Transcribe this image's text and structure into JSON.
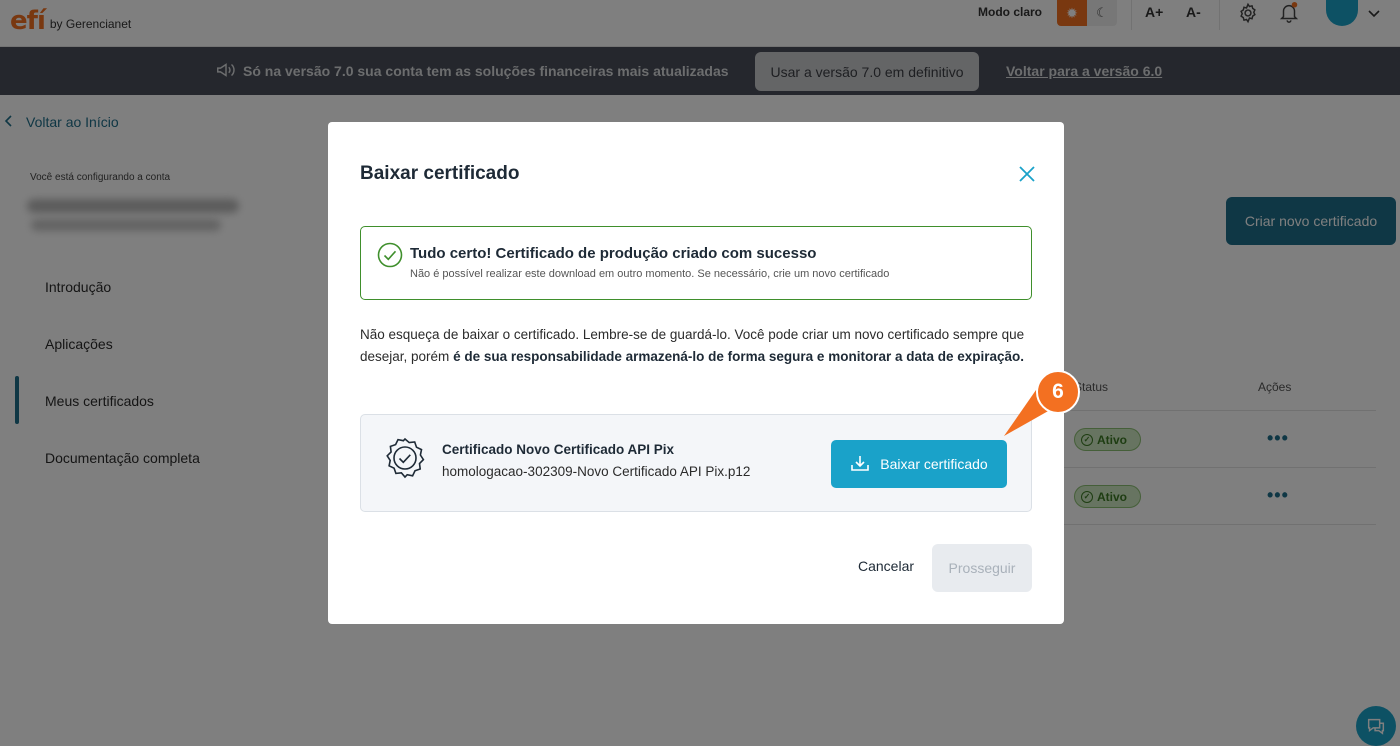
{
  "header": {
    "logo_text": "efí",
    "logo_sub": "by Gerencianet",
    "mode_label": "Modo claro",
    "font_increase": "A+",
    "font_decrease": "A-"
  },
  "banner": {
    "message": "Só na versão 7.0 sua conta tem as soluções financeiras mais atualizadas",
    "primary_button": "Usar a versão 7.0 em definitivo",
    "secondary_link": "Voltar para a versão 6.0"
  },
  "sidebar": {
    "back_label": "Voltar ao Início",
    "account_hint": "Você está configurando a conta",
    "items": [
      {
        "label": "Introdução"
      },
      {
        "label": "Aplicações"
      },
      {
        "label": "Meus certificados"
      },
      {
        "label": "Documentação completa"
      }
    ]
  },
  "main": {
    "create_button": "Criar novo certificado",
    "columns": {
      "status": "Status",
      "actions": "Ações"
    },
    "rows": [
      {
        "status": "Ativo",
        "actions": "•••"
      },
      {
        "status": "Ativo",
        "actions": "•••"
      }
    ]
  },
  "modal": {
    "title": "Baixar certificado",
    "success_title": "Tudo certo! Certificado de produção criado com sucesso",
    "success_subtitle": "Não é possível realizar este download em outro momento. Se necessário, crie um novo certificado",
    "text_intro": "Não esqueça de baixar o certificado. Lembre-se de guardá-lo. Você pode criar um novo certificado sempre que desejar, porém ",
    "text_bold": "é de sua responsabilidade armazená-lo de forma segura e monitorar a data de expiração.",
    "cert_name": "Certificado Novo Certificado API Pix",
    "cert_file": "homologacao-302309-Novo Certificado API Pix.p12",
    "download_button": "Baixar certificado",
    "cancel_button": "Cancelar",
    "proceed_button": "Prosseguir"
  },
  "step_marker": "6",
  "colors": {
    "brand_orange": "#f37021",
    "primary_blue": "#1aa2c9",
    "dark_teal": "#1f6e8a",
    "success_green": "#3f8f2c"
  }
}
